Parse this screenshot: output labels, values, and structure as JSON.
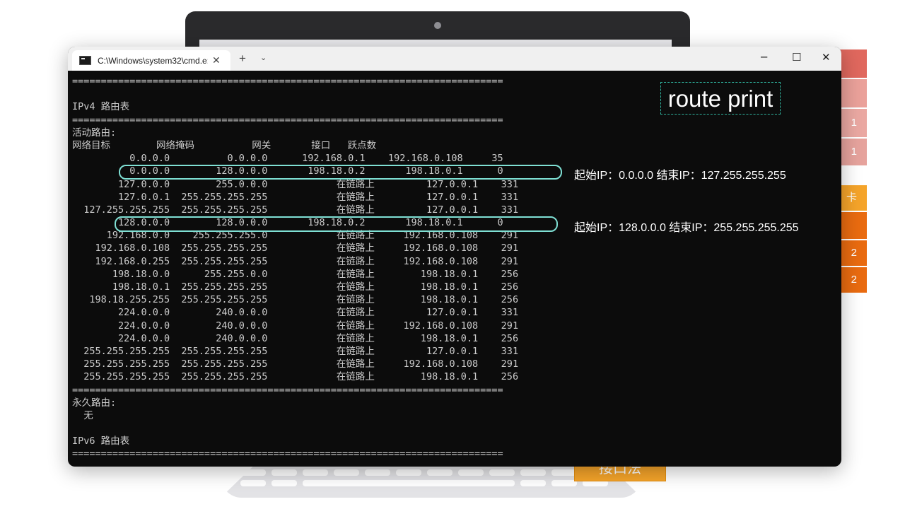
{
  "window": {
    "tab_title": "C:\\Windows\\system32\\cmd.e:",
    "tab_close": "✕",
    "new_tab": "+",
    "tab_dropdown": "⌄",
    "minimize": "─",
    "maximize": "☐",
    "close": "✕"
  },
  "terminal": {
    "lines": [
      "===========================================================================",
      "",
      "IPv4 路由表",
      "===========================================================================",
      "活动路由:",
      "网络目标        网络掩码          网关       接口   跃点数",
      "          0.0.0.0          0.0.0.0      192.168.0.1    192.168.0.108     35",
      "          0.0.0.0        128.0.0.0       198.18.0.2       198.18.0.1      0",
      "        127.0.0.0        255.0.0.0            在链路上         127.0.0.1    331",
      "        127.0.0.1  255.255.255.255            在链路上         127.0.0.1    331",
      "  127.255.255.255  255.255.255.255            在链路上         127.0.0.1    331",
      "        128.0.0.0        128.0.0.0       198.18.0.2       198.18.0.1      0",
      "      192.168.0.0    255.255.255.0            在链路上     192.168.0.108    291",
      "    192.168.0.108  255.255.255.255            在链路上     192.168.0.108    291",
      "    192.168.0.255  255.255.255.255            在链路上     192.168.0.108    291",
      "       198.18.0.0      255.255.0.0            在链路上        198.18.0.1    256",
      "       198.18.0.1  255.255.255.255            在链路上        198.18.0.1    256",
      "   198.18.255.255  255.255.255.255            在链路上        198.18.0.1    256",
      "        224.0.0.0        240.0.0.0            在链路上         127.0.0.1    331",
      "        224.0.0.0        240.0.0.0            在链路上     192.168.0.108    291",
      "        224.0.0.0        240.0.0.0            在链路上        198.18.0.1    256",
      "  255.255.255.255  255.255.255.255            在链路上         127.0.0.1    331",
      "  255.255.255.255  255.255.255.255            在链路上     192.168.0.108    291",
      "  255.255.255.255  255.255.255.255            在链路上        198.18.0.1    256",
      "===========================================================================",
      "永久路由:",
      "  无",
      "",
      "IPv6 路由表",
      "==========================================================================="
    ]
  },
  "annotations": {
    "command": "route print",
    "route1_range": "起始IP：0.0.0.0 结束IP：127.255.255.255",
    "route2_range": "起始IP：128.0.0.0 结束IP：255.255.255.255"
  },
  "background": {
    "side_labels": [
      "1",
      "1",
      "卡",
      "2",
      "2"
    ],
    "bottom_label": "接口法"
  },
  "colors": {
    "terminal_bg": "#0c0c0c",
    "terminal_text": "#cccccc",
    "highlight": "#7fe0d4",
    "dashed_border": "#2fb59f"
  }
}
